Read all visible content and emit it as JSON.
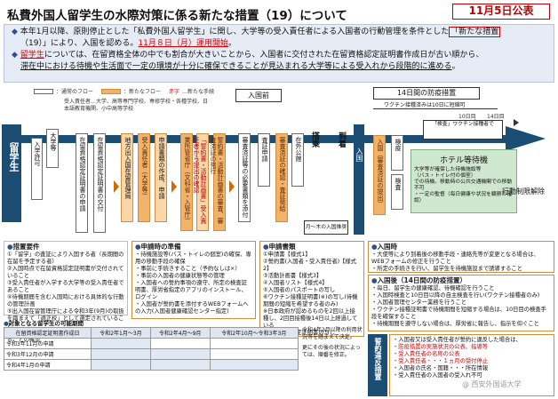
{
  "header": {
    "title": "私費外国人留学生の水際対策に係る新たな措置（19）について",
    "date_badge": "11月5日公表"
  },
  "intro": {
    "p1_a": "本年1月以降、原則停止とした「私費外国人留学生」に関し、大学等の受入責任者による入国者の行動管理を条件とした",
    "p1_box": "「新たな措置",
    "p1_b": "（19）」",
    "p1_c": "により、入国を認める。",
    "p1_red": "11月８日（月）運用開始",
    "p1_end": "。",
    "p2_red": "留学生",
    "p2_a": "については、在留資格全体の中でも割合が大きいことから、入国者に交付された在留資格認定証明書作成日が古い順から、",
    "p3_a": "滞在中における待機や生活面で一定の環境が十分に確保できることが見込まれる大学等による受入れから段階的に進める",
    "p3_b": "。"
  },
  "legend": {
    "normal": "：通常のフロー",
    "new": "：新たなフロー",
    "new_label": "赤字",
    "new_text": "…新たな手続",
    "sponsors": "受入責任者…大学、高等専門学校、専修学校・各種学校、日本語教育機関、小中高等学校"
  },
  "timeline": {
    "pre_entry": "入国前",
    "quarantine_title": "14日間の防疫措置",
    "quarantine_sub": "ワクチン接種済みは10日に短縮可",
    "day10": "10日目",
    "day14": "14日目",
    "student_label": "留学生",
    "sponsor": "大学等",
    "entry_permit": "入学許可",
    "coe_apply": "在留資格認定証明書の申請",
    "coe_issue": "在留資格認定証明書の交付",
    "local_dept": "地方出入国在留管理局",
    "pledge_prep": "受入責任者（大学等）",
    "pledge_text": "申請書類の作成、申請",
    "ministry": "業所管省庁（文科省・入管庁）",
    "ministry_sub": "「誓約書・活動計画書」受入責任者から提出の確認",
    "application_review": "誓約書・活動計画書の審査、審査済証の発行",
    "doc_attach": "審査済証等の必要書類を添付",
    "visa": "在外公館",
    "visa_sub": "査証の発給",
    "visa_apply": "査証申請",
    "review_cert": "審査済証の確認・査証発給",
    "boarding": "搭乗",
    "arrival": "到着",
    "entry": "入国",
    "reentry": "入国（審査済証の提出）",
    "quarantine": "検疫",
    "inspection": "検査",
    "hotel": "ホテル等待機",
    "hotel_notes": [
      "大学等が確保した待機施設等",
      "（バス・トイレ付の個室）",
      "での待機。移動時の公共交通機関での移動不可",
      "・一定の監督（毎日健康や状況を観察の確認）"
    ],
    "release": "行動制限解除",
    "vaccine_note": "「検査」ワクチン接種者で",
    "before_ix_note": "月～木の入国推奨"
  },
  "panels": {
    "requirements": {
      "title": "措置要件",
      "items": [
        "①「留学」の査証により入国する者（長期間の在留を予定する者）",
        "②入国時点で在留資格認定証明書が交付されていること",
        "③受入責任者が入学する大学等の受入責任者であること",
        "④待機期間を含む入国時における具体的な行動の管理計画",
        "⑤出入国在留管理庁による令和3年(9月)の取扱を踏まえて「適正校」として選定されていること",
        "※上記のほか、受入責任者が要件を満たしていることの確認"
      ]
    },
    "preparation": {
      "title": "申請時の準備",
      "items": [
        "・待機施設等(バス・トイレの個室)の確保、専用の移動手段の確保",
        "・事前に手続きすること（予約なしは×）",
        "・事前の入国者の健康状態等の管理",
        "・入国者への誓約事項の遵守、所定の検査証明書、厚労省指定のアプリのインストール、ログイン",
        "・入国者が誓約書を添付するWEBフォームへの入力(入国者健康確認センター指定)"
      ]
    },
    "documents": {
      "title": "申請書類",
      "items": [
        "①申請書【様式1】",
        "②誓約書(入国者・受入責任者)【様式2】",
        "③活動計画書【様式3】",
        "④入国者リスト【様式4】",
        "⑤入国者のパスポートの写し",
        "⑥ワクチン接種証明書(※)の写し(待機期間の短縮を希望する者のみ)",
        "※日本政府が認めるものを2回以上接種し、2回目接種後14日以上経過している",
        "⑦在留資格認定証明書の写し"
      ]
    },
    "entry_time": {
      "title": "入国時",
      "items": [
        "・大使等により到着後の移動手段・連絡先等が変更となる場合は、WEBフォームの修正を行うこと",
        "・所定の手続きを行い、留学生を待機施設まで誘導すること"
      ]
    },
    "after_entry": {
      "title": "入国後（14日間の防疫措置）",
      "items": [
        "・毎日、留学生の健康確認、待機確認を行うこと",
        "・入国時検査と10日目以降の自主検査を行い(ワクチン接種者のみ)",
        "・入国者管理センター業務を行うこと",
        "・ワクチン接種証明書で待機期間を短縮する場合は、10日目の検査手段を確保すること",
        "・待機期間を遵守しない場合は、厚労省に報告し、指示を仰ぐこと",
        "・保健所への報告等を行い、連絡体制を整備（様式5-1～3）を省庁窓口に提出すること"
      ]
    },
    "violations": {
      "side_label": "誓約違反措置",
      "items": [
        "・入国者又は受入責任者が誓約に違反した場合は、",
        "・防疫措置の実施状況の公表、指導等",
        "・受入責任者の名称の公表",
        "・受入責任者・・・１ヵ月の受付停止",
        "・入国者の氏名・国籍・・・所在情報",
        "・受入責任者の入国者の受入れ不可"
      ]
    },
    "coe_table": {
      "title": "対象となる留学生の可能期間",
      "headers": [
        "在留資格認定証明書作成日",
        "令和2年1月～3月",
        "令和2年4月～9月",
        "令和2年10月～令和3年3月"
      ],
      "rows": [
        [
          "令和3年11月の申請",
          "",
          "",
          ""
        ],
        [
          "令和3年12月の申請",
          "",
          "",
          ""
        ],
        [
          "令和4年1月の申請",
          "",
          "",
          ""
        ]
      ],
      "note1": "令和4年2月以降の利用状況等を踏まえて決定。",
      "note2": "更にその後の状況によっては、順番を修正。"
    }
  },
  "watermark": "@ 西安外国语大学"
}
